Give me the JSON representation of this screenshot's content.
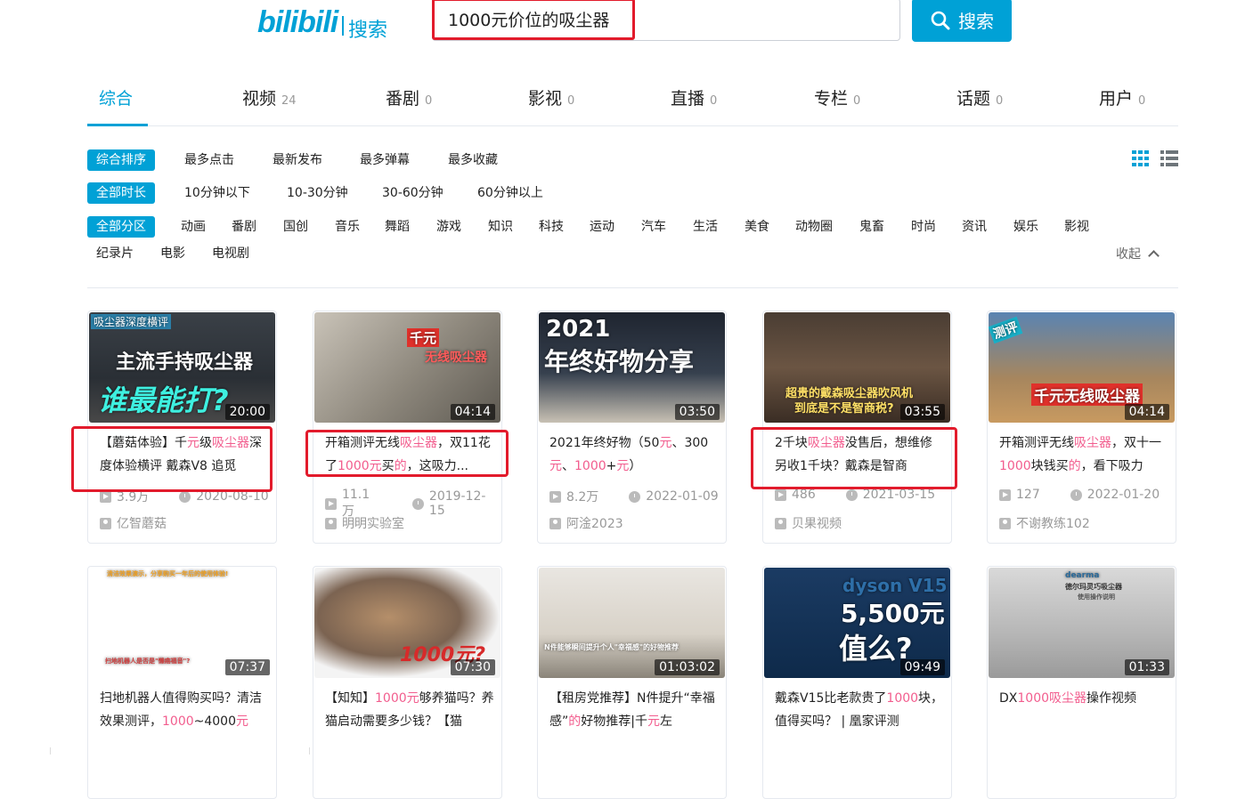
{
  "header": {
    "logo_brand": "bilibili",
    "logo_word": "搜索",
    "search_value": "1000元价位的吸尘器",
    "search_button": "搜索"
  },
  "tabs": [
    {
      "label": "综合",
      "count": ""
    },
    {
      "label": "视频",
      "count": "24"
    },
    {
      "label": "番剧",
      "count": "0"
    },
    {
      "label": "影视",
      "count": "0"
    },
    {
      "label": "直播",
      "count": "0"
    },
    {
      "label": "专栏",
      "count": "0"
    },
    {
      "label": "话题",
      "count": "0"
    },
    {
      "label": "用户",
      "count": "0"
    }
  ],
  "filters": {
    "order": [
      "综合排序",
      "最多点击",
      "最新发布",
      "最多弹幕",
      "最多收藏"
    ],
    "duration": [
      "全部时长",
      "10分钟以下",
      "10-30分钟",
      "30-60分钟",
      "60分钟以上"
    ],
    "zone": [
      "全部分区",
      "动画",
      "番剧",
      "国创",
      "音乐",
      "舞蹈",
      "游戏",
      "知识",
      "科技",
      "运动",
      "汽车",
      "生活",
      "美食",
      "动物圈",
      "鬼畜",
      "时尚",
      "资讯",
      "娱乐",
      "影视",
      "纪录片",
      "电影",
      "电视剧"
    ],
    "collapse": "收起"
  },
  "videos": [
    {
      "overlay": [
        "吸尘器深度横评",
        "主流手持吸尘器",
        "谁最能打?"
      ],
      "duration": "20:00",
      "title": [
        [
          "【蘑菇体验】千",
          ""
        ],
        [
          "元",
          "hl"
        ],
        [
          "级",
          ""
        ],
        [
          "吸尘器",
          "hl"
        ],
        [
          "深度体验横评 戴森V8 追觅",
          ""
        ]
      ],
      "views": "3.9万",
      "date": "2020-08-10",
      "uploader": "亿智蘑菇"
    },
    {
      "overlay": [
        "千元",
        "无线吸尘器"
      ],
      "duration": "04:14",
      "title": [
        [
          "开箱测评无线",
          ""
        ],
        [
          "吸尘器",
          "hl"
        ],
        [
          "，双11花了",
          ""
        ],
        [
          "1000元",
          "hl"
        ],
        [
          "买",
          ""
        ],
        [
          "的",
          "hl"
        ],
        [
          "，这吸力...",
          ""
        ]
      ],
      "views": "11.1万",
      "date": "2019-12-15",
      "uploader": "明明实验室"
    },
    {
      "overlay": [
        "2021",
        "年终好物分享"
      ],
      "duration": "03:50",
      "title": [
        [
          "2021年终好物（50",
          ""
        ],
        [
          "元",
          "hl"
        ],
        [
          "、300",
          ""
        ],
        [
          "元",
          "hl"
        ],
        [
          "、",
          ""
        ],
        [
          "1000",
          "hl"
        ],
        [
          "+",
          ""
        ],
        [
          "元",
          "hl"
        ],
        [
          "）",
          ""
        ]
      ],
      "views": "8.2万",
      "date": "2022-01-09",
      "uploader": "阿淦2023"
    },
    {
      "overlay": [
        "超贵的戴森吸尘器吹风机",
        "到底是不是智商税?"
      ],
      "duration": "03:55",
      "title": [
        [
          "2千块",
          ""
        ],
        [
          "吸尘器",
          "hl"
        ],
        [
          "没售后，想维修另收1千块？戴森是智商",
          ""
        ]
      ],
      "views": "486",
      "date": "2021-03-15",
      "uploader": "贝果视频"
    },
    {
      "overlay": [
        "测评",
        "千元无线吸尘器"
      ],
      "duration": "04:14",
      "title": [
        [
          "开箱测评无线",
          ""
        ],
        [
          "吸尘器",
          "hl"
        ],
        [
          "，双十一",
          ""
        ],
        [
          "1000",
          "hl"
        ],
        [
          "块钱买",
          ""
        ],
        [
          "的",
          "hl"
        ],
        [
          "，看下吸力",
          ""
        ]
      ],
      "views": "127",
      "date": "2022-01-20",
      "uploader": "不谢教练102"
    },
    {
      "overlay": [
        "清洁效果演示，分享购买一年后的使用体验!",
        "扫地机器人是否是\"懒癌福音\"?"
      ],
      "duration": "07:37",
      "title": [
        [
          "扫地机器人值得购买吗？清洁效果测评，",
          ""
        ],
        [
          "1000",
          "hl"
        ],
        [
          "~4000",
          ""
        ],
        [
          "元",
          "hl"
        ]
      ],
      "views": "",
      "date": "",
      "uploader": ""
    },
    {
      "overlay": [
        "1000元?"
      ],
      "duration": "07:30",
      "title": [
        [
          "【知知】",
          ""
        ],
        [
          "1000元",
          "hl"
        ],
        [
          "够养猫吗？养猫启动需要多少钱？【猫",
          ""
        ]
      ],
      "views": "",
      "date": "",
      "uploader": ""
    },
    {
      "overlay": [
        "N件能够瞬间提升个人\"幸福感\"的好物推荐"
      ],
      "duration": "01:03:02",
      "title": [
        [
          "【租房党推荐】N件提升“幸福感”",
          ""
        ],
        [
          "的",
          "hl"
        ],
        [
          "好物推荐|千",
          ""
        ],
        [
          "元",
          "hl"
        ],
        [
          "左",
          ""
        ]
      ],
      "views": "",
      "date": "",
      "uploader": ""
    },
    {
      "overlay": [
        "dyson V15",
        "5,500元",
        "值么?"
      ],
      "duration": "09:49",
      "title": [
        [
          "戴森V15比老款贵了",
          ""
        ],
        [
          "1000",
          "hl"
        ],
        [
          "块，值得买吗？ | 凰家评测",
          ""
        ]
      ],
      "views": "",
      "date": "",
      "uploader": ""
    },
    {
      "overlay": [
        "dearma",
        "德尔玛灵巧吸尘器",
        "使用操作说明"
      ],
      "duration": "01:33",
      "title": [
        [
          "DX",
          ""
        ],
        [
          "1000",
          "hl"
        ],
        [
          "吸尘器",
          "hl"
        ],
        [
          "操作视频",
          ""
        ]
      ],
      "views": "",
      "date": "",
      "uploader": ""
    }
  ],
  "colors": {
    "accent": "#00a1d6",
    "highlight": "#f25d8e",
    "annotation": "#e21b2c"
  }
}
